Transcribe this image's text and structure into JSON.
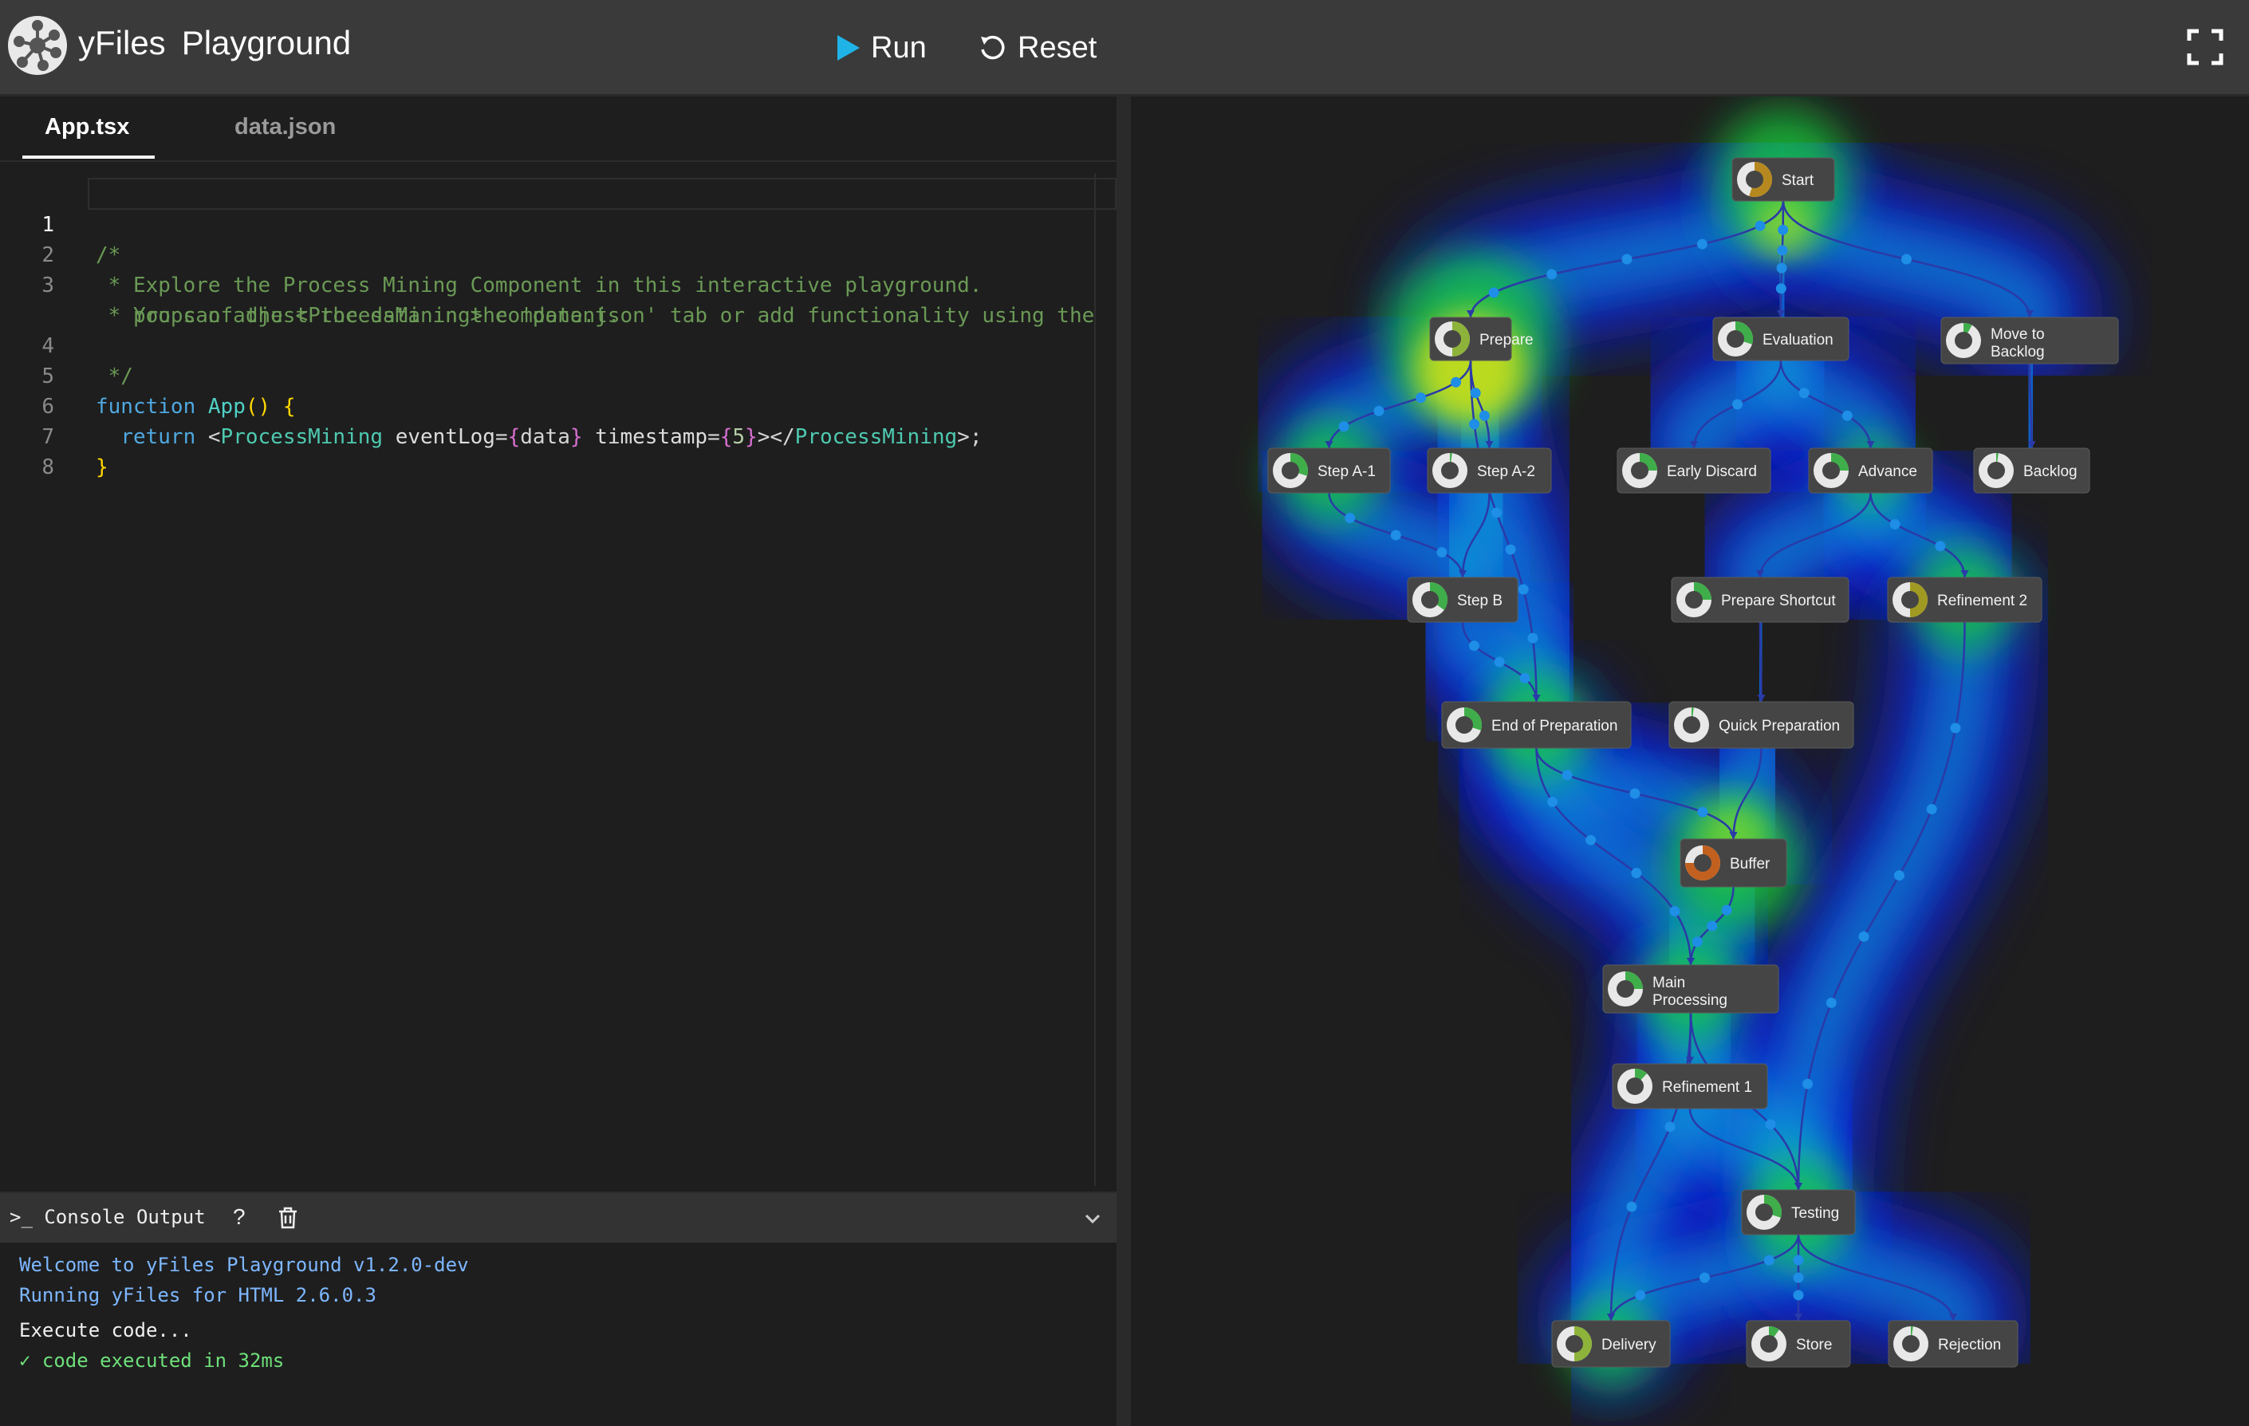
{
  "header": {
    "logo_text": "yFiles",
    "app_name": "Playground",
    "run_label": "Run",
    "reset_label": "Reset"
  },
  "editor": {
    "tabs": [
      {
        "label": "App.tsx",
        "active": true
      },
      {
        "label": "data.json",
        "active": false
      }
    ],
    "line_numbers": [
      "1",
      "2",
      "3",
      "4",
      "5",
      "6",
      "7",
      "8"
    ],
    "comment_lines": [
      "/*",
      " * Explore the Process Mining Component in this interactive playground.",
      " * You can adjust the data in the 'data.json' tab or add functionality using the",
      "   props of the <ProcessMining> component.",
      " */"
    ],
    "code": {
      "function_kw": "function",
      "function_name": "App",
      "return_kw": "return",
      "component": "ProcessMining",
      "attr1": "eventLog",
      "attr1_value": "data",
      "attr2": "timestamp",
      "attr2_value": "5"
    }
  },
  "console": {
    "title": ">_ Console Output",
    "help_label": "?",
    "lines": [
      {
        "text": "Welcome to yFiles Playground v1.2.0-dev",
        "style": "blue"
      },
      {
        "text": "Running yFiles for HTML 2.6.0.3",
        "style": "blue"
      },
      {
        "text": "Execute code...",
        "style": "white"
      },
      {
        "text": "✓ code executed in 32ms",
        "style": "green"
      }
    ]
  },
  "graph": {
    "nodes": [
      {
        "id": "start",
        "label": "Start",
        "pie": 0.55,
        "color": "#b5891f"
      },
      {
        "id": "prepare",
        "label": "Prepare",
        "pie": 0.5,
        "color": "#8db33a"
      },
      {
        "id": "evaluation",
        "label": "Evaluation",
        "pie": 0.3,
        "color": "#3fae4a"
      },
      {
        "id": "move_to_backlog",
        "label": "Move to Backlog",
        "pie": 0.08,
        "color": "#3fae4a"
      },
      {
        "id": "step_a1",
        "label": "Step A-1",
        "pie": 0.3,
        "color": "#3fae4a"
      },
      {
        "id": "step_a2",
        "label": "Step A-2",
        "pie": 0.02,
        "color": "#3fae4a"
      },
      {
        "id": "early_discard",
        "label": "Early Discard",
        "pie": 0.25,
        "color": "#3fae4a"
      },
      {
        "id": "advance",
        "label": "Advance",
        "pie": 0.25,
        "color": "#3fae4a"
      },
      {
        "id": "backlog",
        "label": "Backlog",
        "pie": 0.02,
        "color": "#3fae4a"
      },
      {
        "id": "step_b",
        "label": "Step B",
        "pie": 0.35,
        "color": "#3fae4a"
      },
      {
        "id": "prepare_shortcut",
        "label": "Prepare Shortcut",
        "pie": 0.25,
        "color": "#3fae4a"
      },
      {
        "id": "refinement2",
        "label": "Refinement 2",
        "pie": 0.5,
        "color": "#a09a22"
      },
      {
        "id": "end_of_preparation",
        "label": "End of Preparation",
        "pie": 0.3,
        "color": "#3fae4a"
      },
      {
        "id": "quick_preparation",
        "label": "Quick Preparation",
        "pie": 0.02,
        "color": "#3fae4a"
      },
      {
        "id": "buffer",
        "label": "Buffer",
        "pie": 0.75,
        "color": "#c2611f"
      },
      {
        "id": "main_processing",
        "label": "Main Processing",
        "pie": 0.25,
        "color": "#3fae4a"
      },
      {
        "id": "refinement1",
        "label": "Refinement 1",
        "pie": 0.12,
        "color": "#3fae4a"
      },
      {
        "id": "testing",
        "label": "Testing",
        "pie": 0.3,
        "color": "#3fae4a"
      },
      {
        "id": "delivery",
        "label": "Delivery",
        "pie": 0.5,
        "color": "#8db33a"
      },
      {
        "id": "store",
        "label": "Store",
        "pie": 0.1,
        "color": "#3fae4a"
      },
      {
        "id": "rejection",
        "label": "Rejection",
        "pie": 0.02,
        "color": "#3fae4a"
      }
    ]
  }
}
